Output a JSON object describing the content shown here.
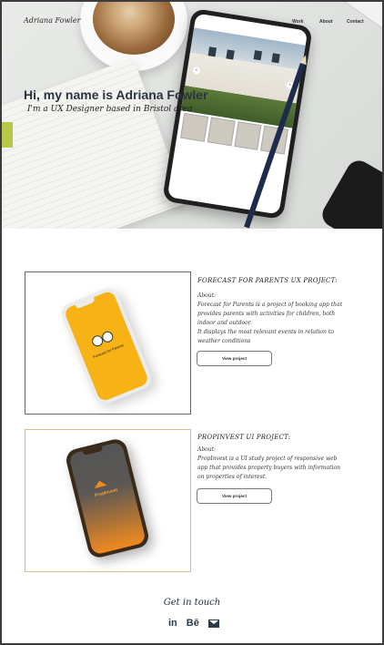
{
  "brand": {
    "name": "Adriana Fowler"
  },
  "nav": {
    "items": [
      "Work",
      "About",
      "Contact"
    ]
  },
  "hero": {
    "title": "Hi, my name is Adriana Fowler",
    "subtitle": "I'm a UX Designer based in Bristol area"
  },
  "projects": [
    {
      "title": "FORECAST FOR PARENTS UX PROJECT:",
      "about_label": "About:",
      "description": "Forecast for Parents is a project of booking app that provides parents with activities for children, both indoor and outdoor.",
      "description2": "It displays the most relevant events in relation to weather conditions",
      "button_label": "View project",
      "phone_label": "Forecast for Parents",
      "accent": "#f7b316"
    },
    {
      "title": "PROPINVEST UI PROJECT:",
      "about_label": "About:",
      "description": "PropInvest is a UI study project of responsive web app that provides property buyers with information on properties of interest.",
      "button_label": "View project",
      "phone_label": "PropInvest",
      "accent": "#f08a1f"
    }
  ],
  "footer": {
    "heading": "Get in touch",
    "socials": {
      "linkedin": "in",
      "behance": "Bē"
    },
    "icons": [
      "linkedin-icon",
      "behance-icon",
      "mail-icon"
    ]
  }
}
